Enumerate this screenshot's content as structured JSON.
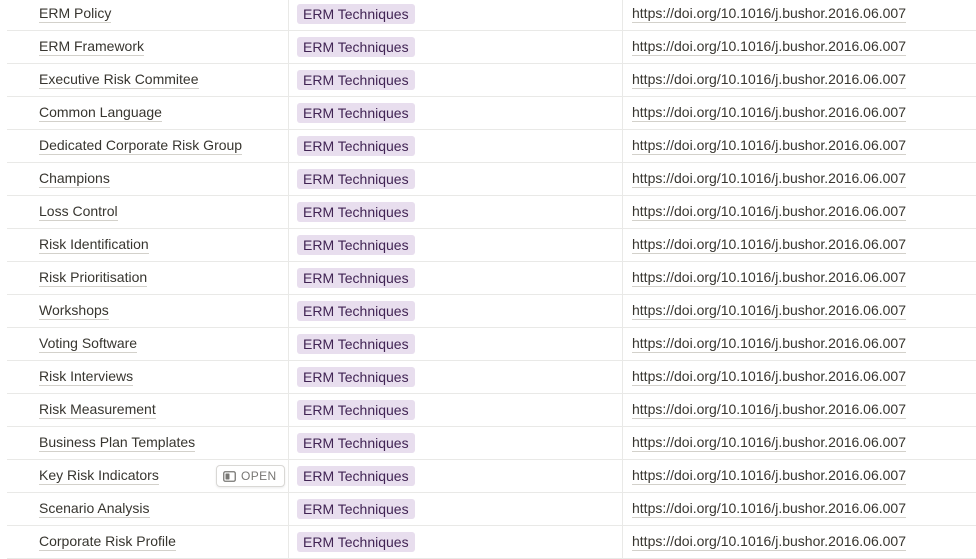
{
  "rows": [
    {
      "name": "ERM Policy",
      "tag": "ERM Techniques",
      "url": "https://doi.org/10.1016/j.bushor.2016.06.007"
    },
    {
      "name": "ERM Framework",
      "tag": "ERM Techniques",
      "url": "https://doi.org/10.1016/j.bushor.2016.06.007"
    },
    {
      "name": "Executive Risk Commitee",
      "tag": "ERM Techniques",
      "url": "https://doi.org/10.1016/j.bushor.2016.06.007"
    },
    {
      "name": "Common Language",
      "tag": "ERM Techniques",
      "url": "https://doi.org/10.1016/j.bushor.2016.06.007"
    },
    {
      "name": "Dedicated Corporate Risk Group",
      "tag": "ERM Techniques",
      "url": "https://doi.org/10.1016/j.bushor.2016.06.007"
    },
    {
      "name": "Champions",
      "tag": "ERM Techniques",
      "url": "https://doi.org/10.1016/j.bushor.2016.06.007"
    },
    {
      "name": "Loss Control",
      "tag": "ERM Techniques",
      "url": "https://doi.org/10.1016/j.bushor.2016.06.007"
    },
    {
      "name": "Risk Identification",
      "tag": "ERM Techniques",
      "url": "https://doi.org/10.1016/j.bushor.2016.06.007"
    },
    {
      "name": "Risk Prioritisation",
      "tag": "ERM Techniques",
      "url": "https://doi.org/10.1016/j.bushor.2016.06.007"
    },
    {
      "name": "Workshops",
      "tag": "ERM Techniques",
      "url": "https://doi.org/10.1016/j.bushor.2016.06.007"
    },
    {
      "name": "Voting Software",
      "tag": "ERM Techniques",
      "url": "https://doi.org/10.1016/j.bushor.2016.06.007"
    },
    {
      "name": "Risk Interviews",
      "tag": "ERM Techniques",
      "url": "https://doi.org/10.1016/j.bushor.2016.06.007"
    },
    {
      "name": "Risk Measurement",
      "tag": "ERM Techniques",
      "url": "https://doi.org/10.1016/j.bushor.2016.06.007"
    },
    {
      "name": "Business Plan Templates",
      "tag": "ERM Techniques",
      "url": "https://doi.org/10.1016/j.bushor.2016.06.007"
    },
    {
      "name": "Key Risk Indicators",
      "tag": "ERM Techniques",
      "url": "https://doi.org/10.1016/j.bushor.2016.06.007",
      "hovered": true
    },
    {
      "name": "Scenario Analysis",
      "tag": "ERM Techniques",
      "url": "https://doi.org/10.1016/j.bushor.2016.06.007"
    },
    {
      "name": "Corporate Risk Profile",
      "tag": "ERM Techniques",
      "url": "https://doi.org/10.1016/j.bushor.2016.06.007"
    }
  ],
  "open_button": {
    "label": "OPEN",
    "icon": "side-peek-icon"
  },
  "colors": {
    "tag_bg": "#e8deee",
    "tag_text": "#412454",
    "divider": "#e9e9e7",
    "text": "#37352f"
  }
}
